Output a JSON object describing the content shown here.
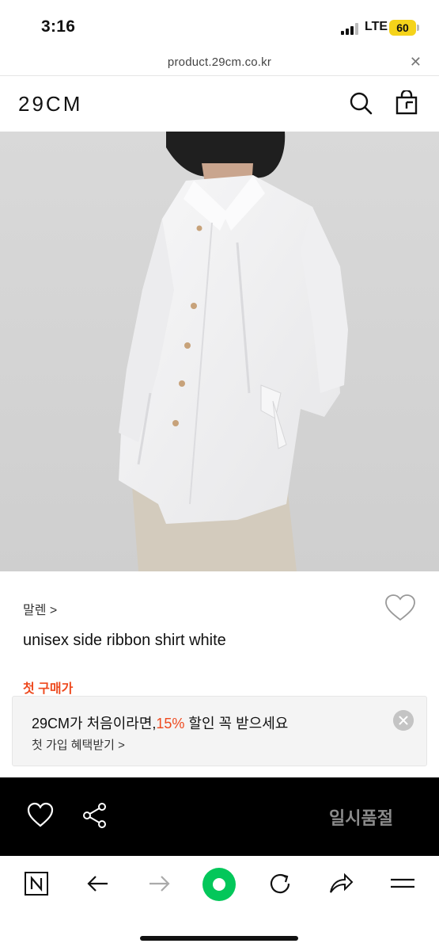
{
  "status_bar": {
    "time": "3:16",
    "network": "LTE",
    "battery": "60"
  },
  "url_bar": {
    "url": "product.29cm.co.kr",
    "close_glyph": "✕"
  },
  "header": {
    "logo": "29CM",
    "icons": [
      "search-icon",
      "shopping-bag-icon"
    ]
  },
  "product": {
    "image_description_icon": "product-photo",
    "brand": "말렌 >",
    "name": "unisex side ribbon shirt white",
    "first_price_label": "첫 구매가"
  },
  "promo": {
    "text_before": "29CM가 처음이라면,",
    "highlight": "15%",
    "text_after": " 할인 꼭 받으세요",
    "subtext": "첫 가입 혜택받기 >"
  },
  "action_bar": {
    "icons": [
      "heart-icon",
      "share-icon"
    ],
    "soldout_label": "일시품절"
  },
  "browser_bar": {
    "icons": [
      "naver-icon",
      "back-arrow-icon",
      "forward-arrow-icon",
      "green-home-icon",
      "reload-icon",
      "share-arrow-icon",
      "menu-icon"
    ]
  },
  "colors": {
    "accent": "#ee4a1f",
    "battery": "#f5d31a",
    "naver_green": "#03c75a"
  }
}
